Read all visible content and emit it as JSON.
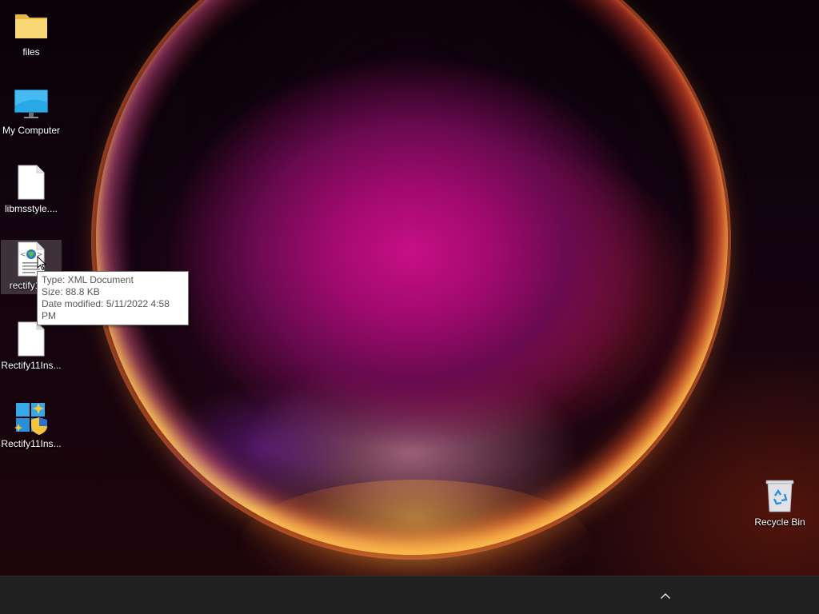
{
  "desktop": {
    "icons": [
      {
        "id": "files",
        "label": "files",
        "icon": "folder-icon"
      },
      {
        "id": "my-computer",
        "label": "My Computer",
        "icon": "monitor-icon"
      },
      {
        "id": "libmsstyle",
        "label": "libmsstyle....",
        "icon": "blank-file-icon"
      },
      {
        "id": "rectify-xml",
        "label": "rectify11...",
        "icon": "xml-document-icon",
        "selected": true
      },
      {
        "id": "rectify-ins-1",
        "label": "Rectify11Ins...",
        "icon": "blank-file-icon"
      },
      {
        "id": "rectify-ins-2",
        "label": "Rectify11Ins...",
        "icon": "installer-shield-icon"
      },
      {
        "id": "recycle-bin",
        "label": "Recycle Bin",
        "icon": "recycle-bin-icon"
      }
    ]
  },
  "tooltip": {
    "type": "Type: XML Document",
    "size": "Size: 88.8 KB",
    "modified": "Date modified: 5/11/2022 4:58 PM"
  },
  "taskbar": {
    "tray_chevron": "chevron-up-icon"
  },
  "colors": {
    "taskbar": "#202020",
    "tooltip_bg": "#ffffff",
    "tooltip_text": "#575757",
    "folder": "#f8d775",
    "monitor": "#29a8e8"
  }
}
